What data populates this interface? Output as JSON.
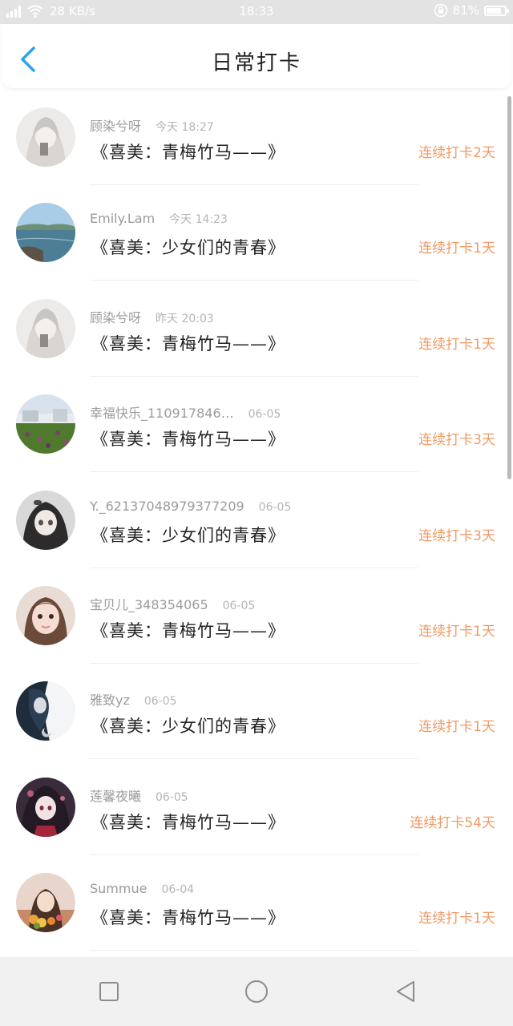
{
  "status_bar": {
    "network_speed": "28 KB/s",
    "time": "18:33",
    "battery": "81%",
    "battery_level": 0.81,
    "icons": [
      "signal-icon",
      "wifi-icon",
      "lock-rotation-icon",
      "battery-icon"
    ]
  },
  "header": {
    "title": "日常打卡",
    "back_icon": "chevron-left-icon",
    "accent_color": "#2aa3ef"
  },
  "checkins": [
    {
      "name": "顾染兮呀",
      "time": "今天 18:27",
      "title": "《喜美：青梅竹马——》",
      "streak": "连续打卡2天",
      "avatar": "anime-girl-white"
    },
    {
      "name": "Emily.Lam",
      "time": "今天 14:23",
      "title": "《喜美：少女们的青春》",
      "streak": "连续打卡1天",
      "avatar": "sea-landscape"
    },
    {
      "name": "顾染兮呀",
      "time": "昨天 20:03",
      "title": "《喜美：青梅竹马——》",
      "streak": "连续打卡1天",
      "avatar": "anime-girl-white"
    },
    {
      "name": "幸福快乐_110917846…",
      "time": "06-05",
      "title": "《喜美：青梅竹马——》",
      "streak": "连续打卡3天",
      "avatar": "garden-landscape"
    },
    {
      "name": "Y._62137048979377209",
      "time": "06-05",
      "title": "《喜美：少女们的青春》",
      "streak": "连续打卡3天",
      "avatar": "anime-girl-dark"
    },
    {
      "name": "宝贝儿_348354065",
      "time": "06-05",
      "title": "《喜美：青梅竹马——》",
      "streak": "连续打卡1天",
      "avatar": "girl-photo"
    },
    {
      "name": "雅致yz",
      "time": "06-05",
      "title": "《喜美：少女们的青春》",
      "streak": "连续打卡1天",
      "avatar": "anime-night"
    },
    {
      "name": "莲馨夜曦",
      "time": "06-05",
      "title": "《喜美：青梅竹马——》",
      "streak": "连续打卡54天",
      "avatar": "anime-girl-red"
    },
    {
      "name": "Summue",
      "time": "06-04",
      "title": "《喜美：青梅竹马——》",
      "streak": "连续打卡1天",
      "avatar": "girl-flowers"
    }
  ],
  "colors": {
    "streak": "#f09a63",
    "title_text": "#222222",
    "meta_text": "#9b9b9b"
  },
  "nav_bar": {
    "buttons": [
      "recent-apps-icon",
      "home-icon",
      "back-triangle-icon"
    ]
  }
}
